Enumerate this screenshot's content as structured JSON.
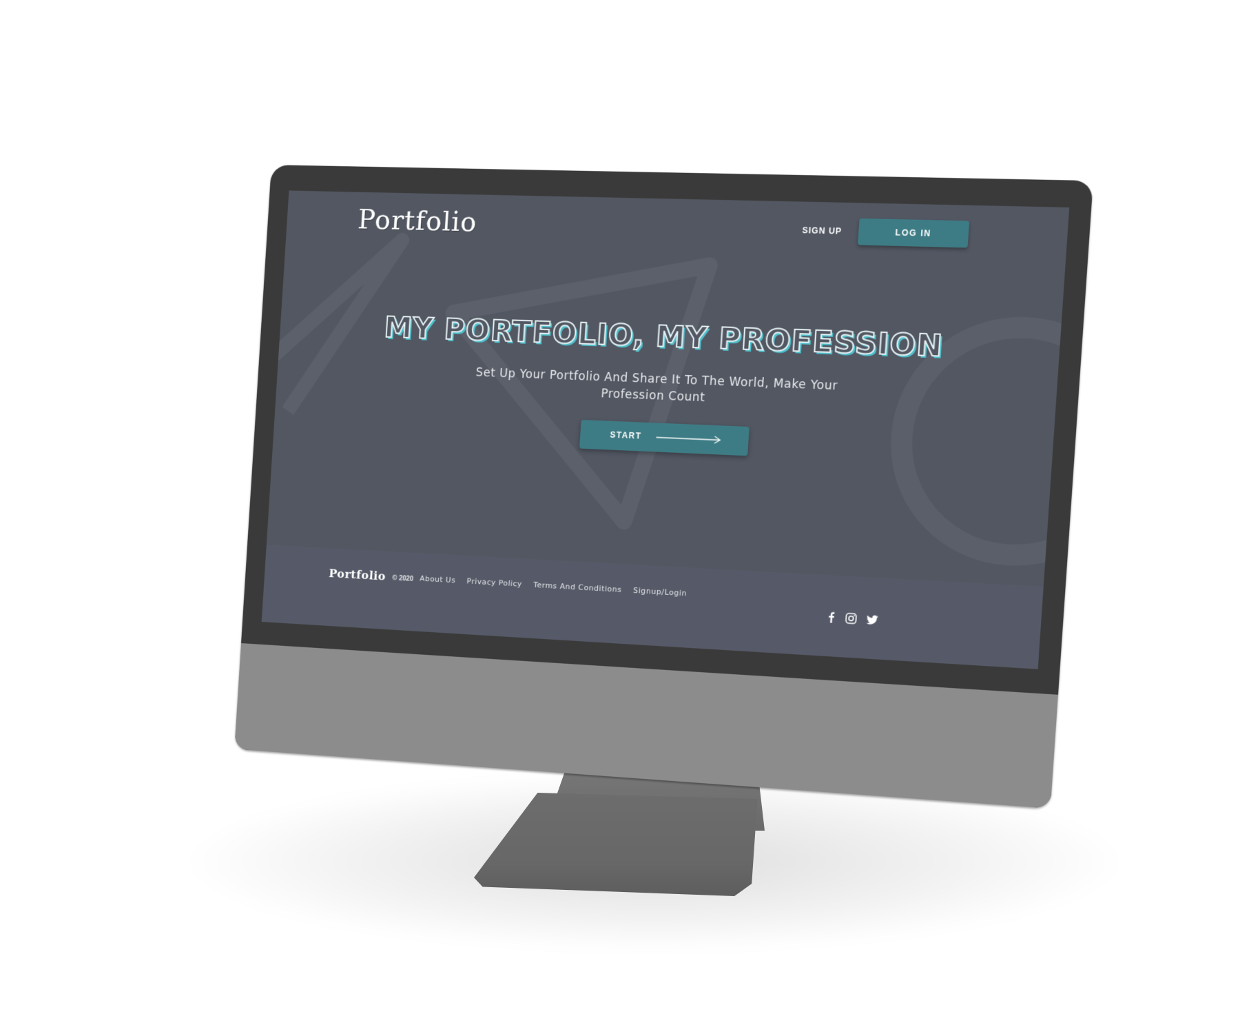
{
  "header": {
    "logo": "Portfolio",
    "signup_label": "SIGN UP",
    "login_label": "LOG IN"
  },
  "hero": {
    "title": "MY PORTFOLIO, MY PROFESSION",
    "subtitle_line1": "Set Up Your Portfolio And Share It To The World, Make Your",
    "subtitle_line2": "Profession Count",
    "start_label": "START",
    "start_icon": "arrow-right-icon"
  },
  "footer": {
    "logo": "Portfolio",
    "copyright": "© 2020",
    "links": [
      {
        "label": "About Us"
      },
      {
        "label": "Privacy Policy"
      },
      {
        "label": "Terms And Conditions"
      },
      {
        "label": "Signup/Login"
      }
    ],
    "social": [
      {
        "icon": "facebook-icon"
      },
      {
        "icon": "instagram-icon"
      },
      {
        "icon": "twitter-icon"
      }
    ]
  },
  "colors": {
    "screen_bg": "#525762",
    "accent": "#3e7c85",
    "title_shadow": "#4ec0cc",
    "bezel": "#3a3a3a",
    "chin": "#8c8c8c"
  }
}
